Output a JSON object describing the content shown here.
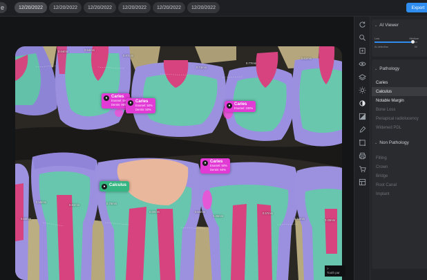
{
  "topbar": {
    "back_label": "e",
    "date_tabs": [
      "12/20/2022",
      "12/20/2022",
      "12/20/2022",
      "12/20/2022",
      "12/20/2022",
      "12/20/2022"
    ],
    "export_label": "Export"
  },
  "viewer": {
    "tooth_badge_line1": ">",
    "tooth_badge_line2": "Tooth par"
  },
  "findings": [
    {
      "type": "caries",
      "title": "Caries",
      "line1": "Enamel: 5%",
      "line2": "Dentin: 95%"
    },
    {
      "type": "caries",
      "title": "Caries",
      "line1": "Enamel: 50%",
      "line2": "Dentin: 50%"
    },
    {
      "type": "caries",
      "title": "Caries",
      "line1": "Enamel: 100%",
      "line2": ""
    },
    {
      "type": "caries",
      "title": "Caries",
      "line1": "Enamel: 50%",
      "line2": "Dentin: 50%"
    },
    {
      "type": "calculus",
      "title": "Calculus",
      "line1": "",
      "line2": ""
    }
  ],
  "measurements": [
    "0.64mm",
    "0.97mm",
    "0.74mm",
    "0.77mm",
    "0.54mm",
    "0.61mm",
    "0.58mm",
    "0.82mm",
    "0.79mm",
    "0.60mm",
    "0.62mm",
    "0.45mm",
    "0.57mm",
    "0.54mm",
    "0.54mm",
    "0.43mm"
  ],
  "tools": [
    "rotate-icon",
    "zoom-icon",
    "crop-icon",
    "eye-icon",
    "brightness-icon",
    "contrast-icon",
    "invert-icon",
    "eyedropper-icon",
    "annotate-icon",
    "print-icon",
    "cart-icon",
    "layout-icon"
  ],
  "panel": {
    "ai_viewer": {
      "title": "AI Viewer",
      "slider_left": "Low",
      "slider_right": "Medium",
      "foot_left": "AI detection",
      "foot_right": "50",
      "value_fraction": 0.9
    },
    "pathology": {
      "title": "Pathology",
      "items": [
        {
          "label": "Caries",
          "state": "on"
        },
        {
          "label": "Calculus",
          "state": "sel"
        },
        {
          "label": "Notable Margin",
          "state": "on"
        },
        {
          "label": "Bone Loss",
          "state": "off"
        },
        {
          "label": "Periapical radiolucency",
          "state": "off"
        },
        {
          "label": "Widened PDL",
          "state": "off"
        }
      ]
    },
    "non_pathology": {
      "title": "Non Pathology",
      "items": [
        {
          "label": "Filling",
          "state": "off"
        },
        {
          "label": "Crown",
          "state": "off"
        },
        {
          "label": "Bridge",
          "state": "off"
        },
        {
          "label": "Root Canal",
          "state": "off"
        },
        {
          "label": "Implant",
          "state": "off"
        }
      ]
    }
  },
  "colors": {
    "accent": "#2f8df0",
    "caries": "#e23ad5",
    "calculus": "#34b582",
    "enamel_overlay": "#9a8ae0",
    "dentin_overlay": "#63c9b0",
    "pulp_overlay": "#d9437f",
    "bone_overlay": "#d8c58a",
    "restoration_overlay": "#e7b89a"
  }
}
